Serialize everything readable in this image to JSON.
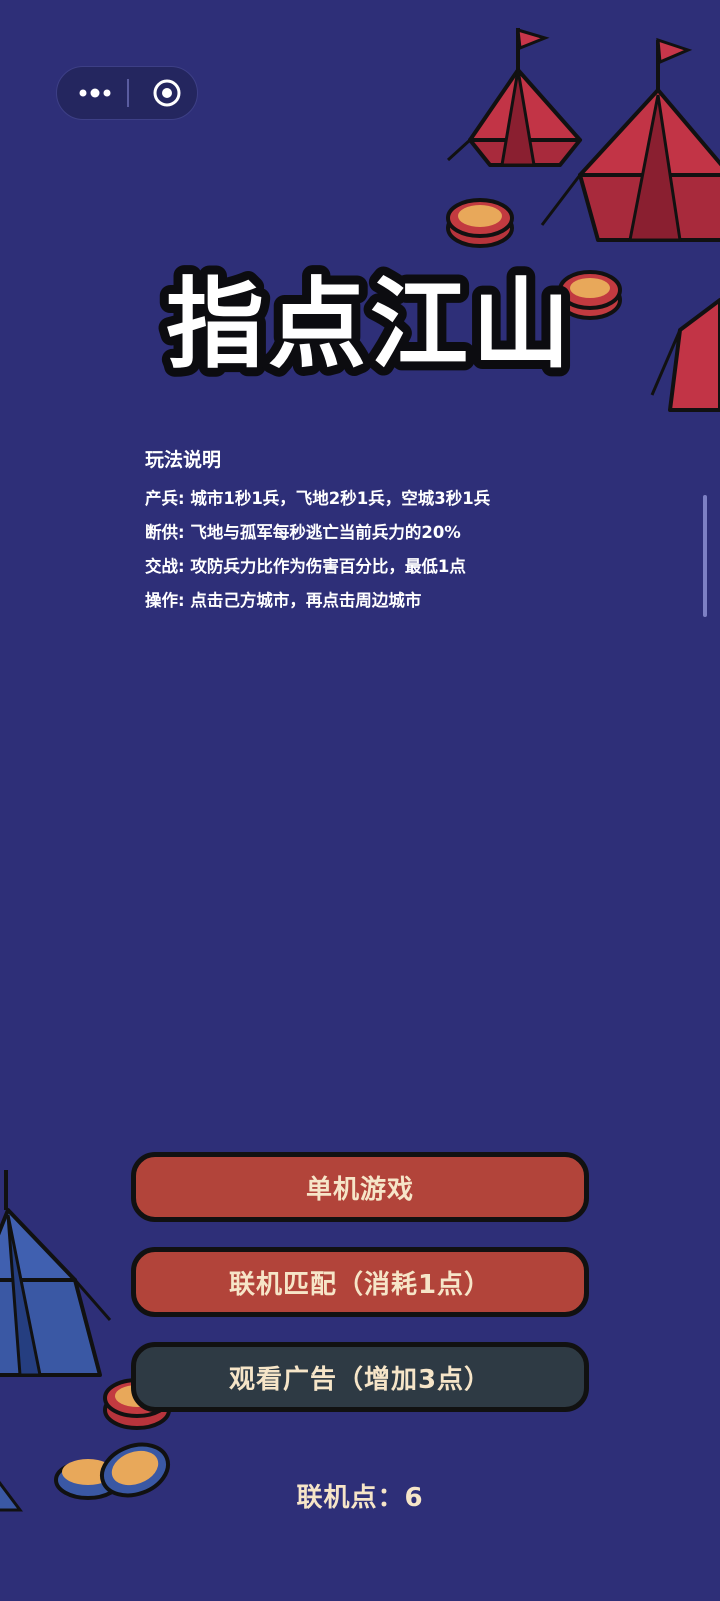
{
  "capsule": {
    "more_icon": "more-dots-icon",
    "close_icon": "target-circle-icon"
  },
  "title": "指点江山",
  "rules": {
    "heading": "玩法说明",
    "lines": [
      "产兵: 城市1秒1兵，飞地2秒1兵，空城3秒1兵",
      "断供: 飞地与孤军每秒逃亡当前兵力的20%",
      "交战: 攻防兵力比作为伤害百分比，最低1点",
      "操作: 点击己方城市，再点击周边城市"
    ]
  },
  "buttons": {
    "single": "单机游戏",
    "online": "联机匹配（消耗1点）",
    "watch_ad": "观看广告（增加3点）"
  },
  "points_label": "联机点：6",
  "colors": {
    "background": "#2e2f78",
    "button_red": "#b2443a",
    "button_dark": "#2e3a44",
    "button_text": "#f6e5c8"
  }
}
